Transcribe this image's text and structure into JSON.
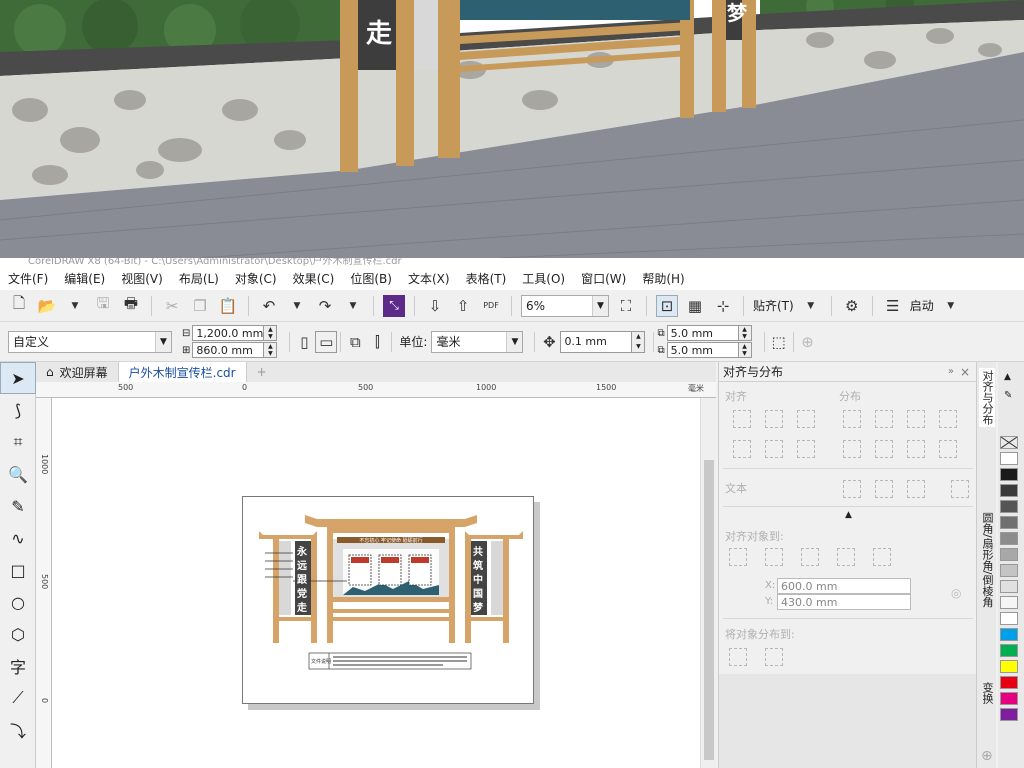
{
  "window": {
    "title": "CorelDRAW X8 (64-Bit) - C:\\Users\\Administrator\\Desktop\\户外木制宣传栏.cdr"
  },
  "scene": {
    "panel_left_chars": [
      "走"
    ],
    "panel_right_chars": [
      "梦"
    ]
  },
  "menu": [
    "文件(F)",
    "编辑(E)",
    "视图(V)",
    "布局(L)",
    "对象(C)",
    "效果(C)",
    "位图(B)",
    "文本(X)",
    "表格(T)",
    "工具(O)",
    "窗口(W)",
    "帮助(H)"
  ],
  "toolbar": {
    "zoom": "6%",
    "snap_label": "贴齐(T)",
    "launch_label": "启动",
    "pdf_label": "PDF"
  },
  "propbar": {
    "page_size": "自定义",
    "width": "1,200.0 mm",
    "height": "860.0 mm",
    "unit_label": "单位:",
    "unit_value": "毫米",
    "nudge": "0.1 mm",
    "dup_x": "5.0 mm",
    "dup_y": "5.0 mm"
  },
  "tabs": [
    "欢迎屏幕",
    "户外木制宣传栏.cdr"
  ],
  "ruler": {
    "h_labels": [
      "500",
      "0",
      "500",
      "1000",
      "1500"
    ],
    "unit": "毫米",
    "v_labels": [
      "1000",
      "500",
      "0"
    ]
  },
  "artwork": {
    "left_banner": [
      "永",
      "远",
      "跟",
      "党",
      "走"
    ],
    "right_banner": [
      "共",
      "筑",
      "中",
      "国",
      "梦"
    ],
    "header_text": "不忘初心 牢记使命 砥砺前行",
    "caption_label": "文件说明"
  },
  "docker": {
    "title": "对齐与分布",
    "align_label": "对齐",
    "distribute_label": "分布",
    "text_label": "文本",
    "align_to_label": "对齐对象到:",
    "x_value": "600.0 mm",
    "y_value": "430.0 mm",
    "x_label": "X:",
    "y_label": "Y:",
    "distribute_to_label": "将对象分布到:"
  },
  "vtabs": [
    "对齐与分布",
    "圆角/扇形角/倒棱角",
    "变换"
  ],
  "palette": [
    "#ffffff",
    "#1a1a1a",
    "#3a3a3a",
    "#555555",
    "#707070",
    "#8c8c8c",
    "#a8a8a8",
    "#c4c4c4",
    "#e0e0e0",
    "#f5f5f5",
    "#ffffff",
    "#00a0e9",
    "#00b050",
    "#ffff00",
    "#e60012",
    "#e4007f",
    "#7f1fa0"
  ]
}
